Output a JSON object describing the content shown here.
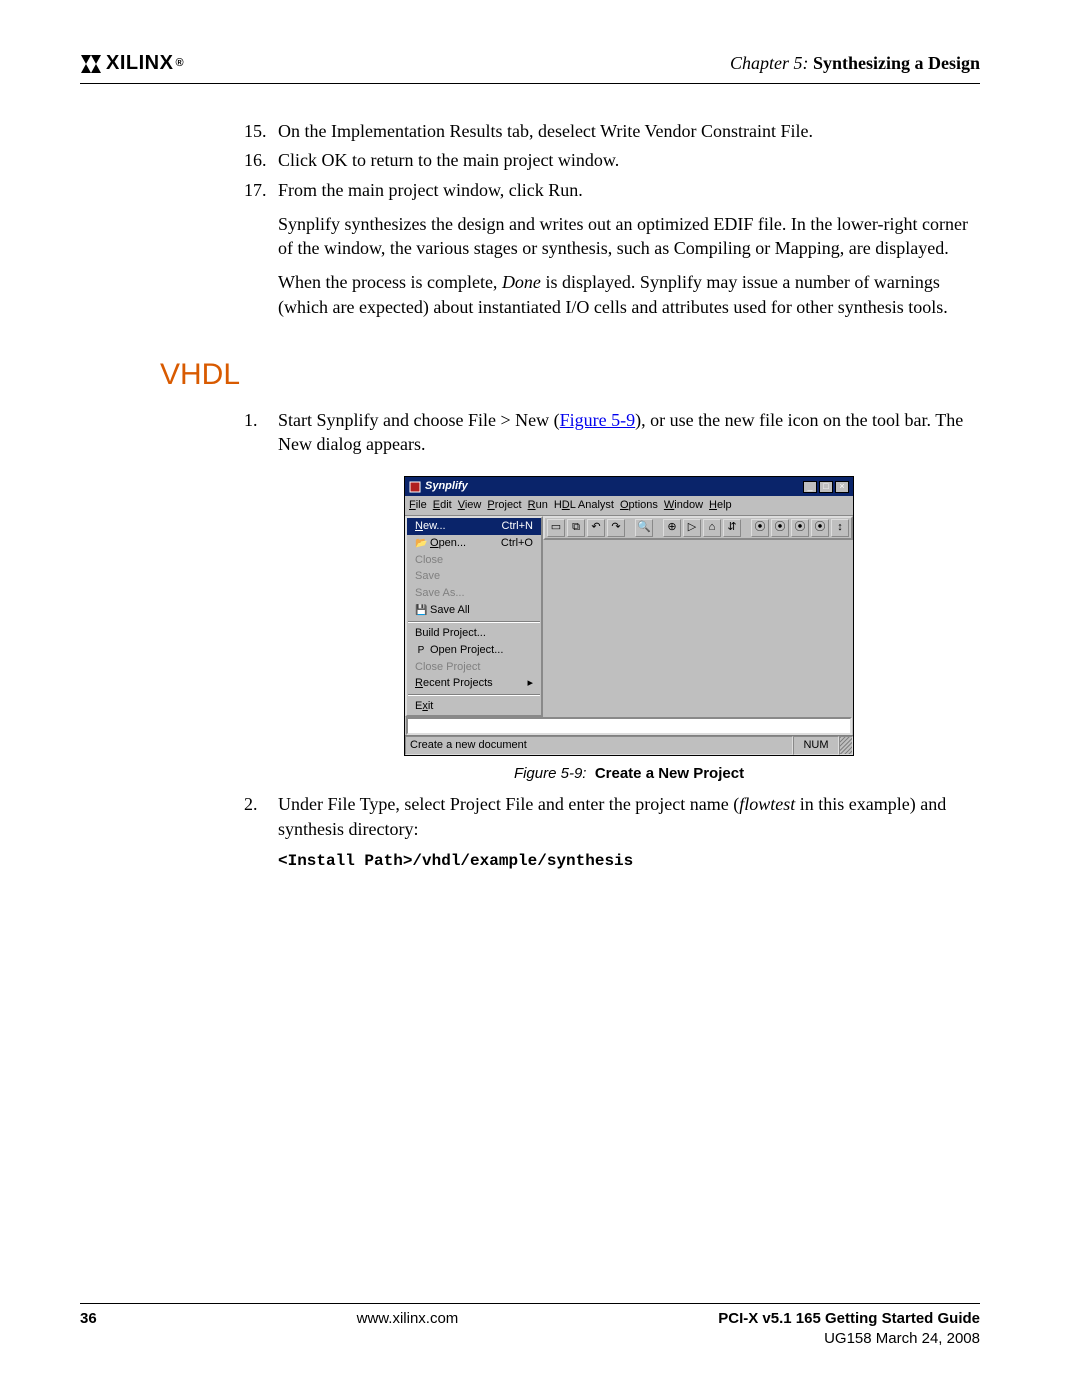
{
  "header": {
    "brand": "XILINX",
    "reg": "®",
    "chapter_prefix": "Chapter 5:  ",
    "chapter_title": "Synthesizing a Design"
  },
  "steps_a": [
    {
      "n": "15.",
      "text": "On the Implementation Results tab, deselect Write Vendor Constraint File."
    },
    {
      "n": "16.",
      "text": "Click OK to return to the main project window."
    },
    {
      "n": "17.",
      "text": "From the main project window, click Run."
    }
  ],
  "para1_a": "Synplify synthesizes the design and writes out an optimized EDIF file. In the lower-right corner of the window, the various stages or synthesis, such as Compiling or Mapping, are displayed.",
  "para1_b_pre": "When the process is complete, ",
  "para1_b_em": "Done",
  "para1_b_post": " is displayed. Synplify may issue a number of warnings (which are expected) about instantiated I/O cells and attributes used for other synthesis tools.",
  "section": "VHDL",
  "step_b1": {
    "n": "1.",
    "pre": "Start Synplify and choose File > New (",
    "linktext": "Figure 5-9",
    "post": "), or use the new file icon on the tool bar. The New dialog appears."
  },
  "figure": {
    "caption_prefix": "Figure 5-9:",
    "caption_title": "Create a New Project"
  },
  "app": {
    "title": "Synplify",
    "menus": [
      "File",
      "Edit",
      "View",
      "Project",
      "Run",
      "HDL Analyst",
      "Options",
      "Window",
      "Help"
    ],
    "filemenu": {
      "new": "New...",
      "new_sc": "Ctrl+N",
      "open": "Open...",
      "open_sc": "Ctrl+O",
      "close": "Close",
      "save": "Save",
      "saveas": "Save As...",
      "saveall": "Save All",
      "build": "Build Project...",
      "openproj": "Open Project...",
      "closeproj": "Close Project",
      "recent": "Recent Projects",
      "exit": "Exit"
    },
    "status": "Create a new document",
    "status_num": "NUM"
  },
  "step_b2": {
    "n": "2.",
    "pre": "Under File Type, select Project File and enter the project name (",
    "em": "flowtest",
    "post": " in this example) and synthesis directory:"
  },
  "codepath": "<Install Path>/vhdl/example/synthesis",
  "footer": {
    "page": "36",
    "url": "www.xilinx.com",
    "title": "PCI-X v5.1 165 Getting Started Guide",
    "date": "UG158 March 24, 2008"
  }
}
